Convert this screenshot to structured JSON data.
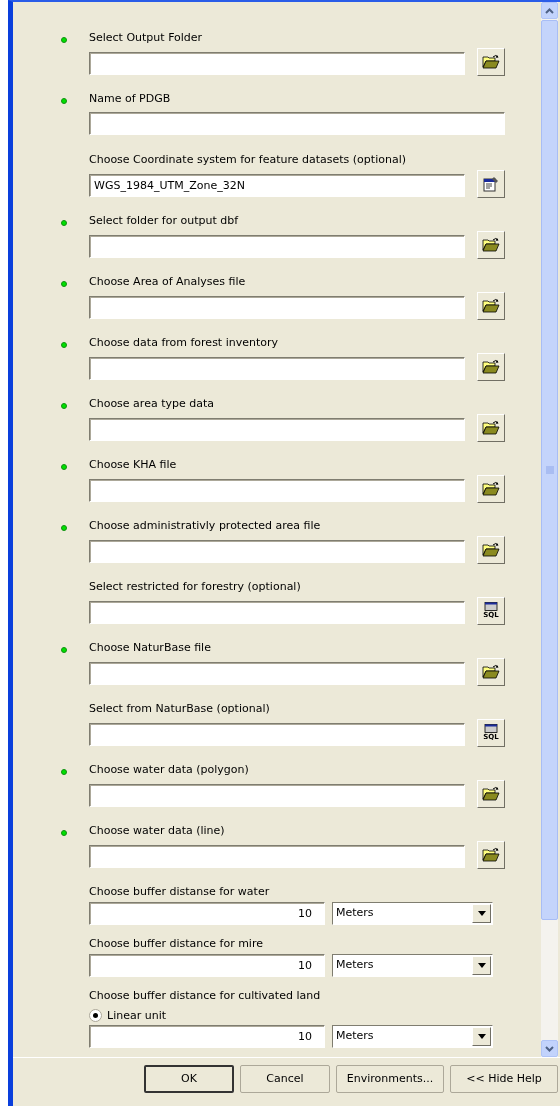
{
  "parameters": [
    {
      "kind": "path",
      "required": true,
      "label": "Select Output Folder",
      "button": {
        "kind": "folder"
      }
    },
    {
      "kind": "path",
      "required": true,
      "label": "Name of PDGB"
    },
    {
      "kind": "path",
      "required": false,
      "label": "Choose Coordinate system  for feature datasets (optional)",
      "value": "WGS_1984_UTM_Zone_32N",
      "button": {
        "kind": "properties"
      }
    },
    {
      "kind": "path",
      "required": true,
      "label": "Select folder for output dbf",
      "button": {
        "kind": "folder"
      }
    },
    {
      "kind": "path",
      "required": true,
      "label": "Choose Area of Analyses file",
      "button": {
        "kind": "folder"
      }
    },
    {
      "kind": "path",
      "required": true,
      "label": "Choose data from forest inventory",
      "button": {
        "kind": "folder"
      }
    },
    {
      "kind": "path",
      "required": true,
      "label": "Choose area type data",
      "button": {
        "kind": "folder"
      }
    },
    {
      "kind": "path",
      "required": true,
      "label": "Choose KHA file",
      "button": {
        "kind": "folder"
      }
    },
    {
      "kind": "path",
      "required": true,
      "label": "Choose administrativly protected area file",
      "button": {
        "kind": "folder"
      }
    },
    {
      "kind": "path",
      "required": false,
      "label": "Select restricted for forestry (optional)",
      "button": {
        "kind": "query",
        "text": "SQL"
      }
    },
    {
      "kind": "path",
      "required": true,
      "label": "Choose NaturBase file",
      "button": {
        "kind": "folder"
      }
    },
    {
      "kind": "path",
      "required": false,
      "label": "Select from NaturBase (optional)",
      "button": {
        "kind": "query",
        "text": "SQL"
      }
    },
    {
      "kind": "path",
      "required": true,
      "label": "Choose water data (polygon)",
      "button": {
        "kind": "folder"
      }
    },
    {
      "kind": "path",
      "required": true,
      "label": "Choose water data (line)",
      "button": {
        "kind": "folder"
      }
    },
    {
      "kind": "distance",
      "required": false,
      "label": "Choose buffer distanse for water",
      "value": "10",
      "unit": "Meters"
    },
    {
      "kind": "distance",
      "required": false,
      "label": "Choose buffer distance for mire",
      "value": "10",
      "unit": "Meters"
    },
    {
      "kind": "distance",
      "required": false,
      "label": "Choose buffer distance for cultivated land",
      "option": {
        "label": "Linear unit",
        "selected": true
      },
      "value": "10",
      "unit": "Meters"
    }
  ],
  "buttons": [
    {
      "label": "OK",
      "default": true
    },
    {
      "label": "Cancel",
      "default": false
    },
    {
      "label": "Environments...",
      "default": false
    },
    {
      "label": "<< Hide Help",
      "default": false
    }
  ]
}
